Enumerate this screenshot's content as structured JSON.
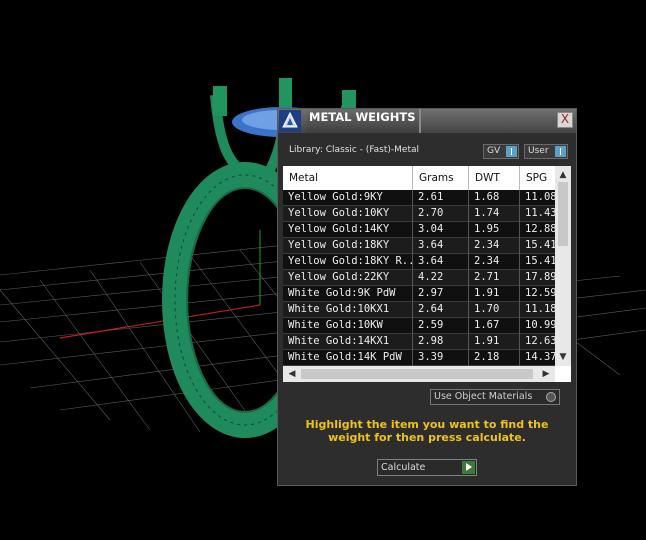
{
  "panel": {
    "title": "METAL WEIGHTS",
    "close": "X",
    "library_label": "Library: Classic - (Fast)-Metal",
    "gv_label": "GV",
    "user_label": "User"
  },
  "table": {
    "headers": [
      "Metal",
      "Grams",
      "DWT",
      "SPG"
    ],
    "rows": [
      [
        "Yellow Gold:9KY",
        "2.61",
        "1.68",
        "11.08"
      ],
      [
        "Yellow Gold:10KY",
        "2.70",
        "1.74",
        "11.43"
      ],
      [
        "Yellow Gold:14KY",
        "3.04",
        "1.95",
        "12.88"
      ],
      [
        "Yellow Gold:18KY",
        "3.64",
        "2.34",
        "15.41"
      ],
      [
        "Yellow Gold:18KY R...",
        "3.64",
        "2.34",
        "15.41"
      ],
      [
        "Yellow Gold:22KY",
        "4.22",
        "2.71",
        "17.89"
      ],
      [
        "White Gold:9K PdW",
        "2.97",
        "1.91",
        "12.59"
      ],
      [
        "White Gold:10KX1",
        "2.64",
        "1.70",
        "11.18"
      ],
      [
        "White Gold:10KW",
        "2.59",
        "1.67",
        "10.99"
      ],
      [
        "White Gold:14KX1",
        "2.98",
        "1.91",
        "12.63"
      ],
      [
        "White Gold:14K PdW",
        "3.39",
        "2.18",
        "14.37"
      ]
    ]
  },
  "use_object_materials": "Use Object Materials",
  "hint": "Highlight the item you want to find the weight for then press calculate.",
  "calculate_label": "Calculate",
  "colors": {
    "panel_bg": "#2d2d2d",
    "hint_yellow": "#f0c21a",
    "ring_green": "#1f8a5c",
    "toggle_blue": "#5aa0c8"
  },
  "icons": {
    "close": "close-icon",
    "logo": "app-logo-icon",
    "scroll_up": "arrow-up-icon",
    "scroll_down": "arrow-down-icon",
    "scroll_left": "arrow-left-icon",
    "scroll_right": "arrow-right-icon",
    "calc_go": "play-arrow-icon"
  }
}
